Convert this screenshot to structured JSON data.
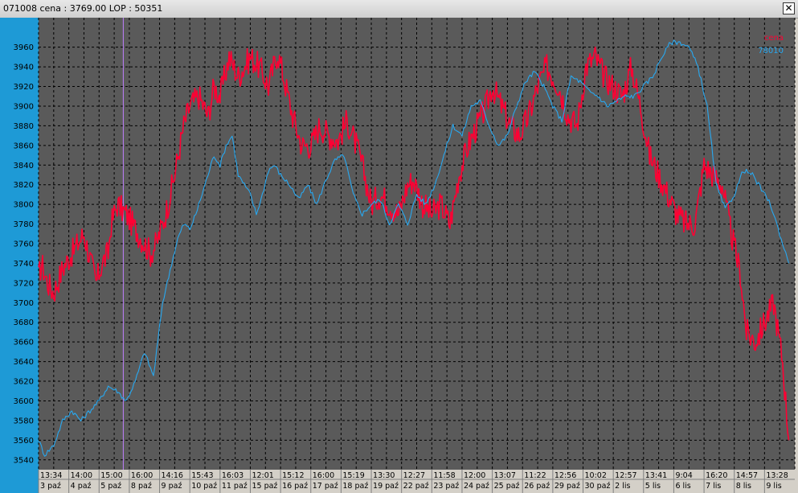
{
  "window": {
    "title": "071008  cena : 3769.00 LOP : 50351",
    "close_glyph": "✕"
  },
  "colors": {
    "plot_bg": "#5a5a5a",
    "axis_bg": "#1e9ad6",
    "grid": "#000000",
    "series_red": "#ff0033",
    "series_blue": "#28a8f0",
    "cursor": "#c080ff"
  },
  "chart_data": {
    "type": "line",
    "grid": true,
    "legend_position": "top-right",
    "ylim": [
      3530,
      3990
    ],
    "y_ticks": [
      3540,
      3560,
      3580,
      3600,
      3620,
      3640,
      3660,
      3680,
      3700,
      3720,
      3740,
      3760,
      3780,
      3800,
      3820,
      3840,
      3860,
      3880,
      3900,
      3920,
      3940,
      3960
    ],
    "x_time_labels": [
      "13:34",
      "14:00",
      "15:00",
      "16:00",
      "14:16",
      "15:43",
      "16:03",
      "12:01",
      "15:12",
      "16:00",
      "15:19",
      "13:30",
      "12:27",
      "11:58",
      "12:00",
      "13:07",
      "11:22",
      "12:56",
      "10:02",
      "12:57",
      "13:41",
      "9:04",
      "16:20",
      "14:57",
      "13:28"
    ],
    "x_date_labels": [
      "3 paź",
      "4 paź",
      "5 paź",
      "8 paź",
      "9 paź",
      "10 paź",
      "11 paź",
      "15 paź",
      "16 paź",
      "17 paź",
      "18 paź",
      "19 paź",
      "22 paź",
      "23 paź",
      "24 paź",
      "25 paź",
      "26 paź",
      "29 paź",
      "30 paź",
      "2 lis",
      "5 lis",
      "6 lis",
      "7 lis",
      "8 lis",
      "9 lis"
    ],
    "series": [
      {
        "name": "cena",
        "color": "#ff0033",
        "style": "noisy",
        "x": [
          0,
          1,
          3,
          5,
          8,
          11,
          15,
          17,
          19,
          21,
          23,
          24,
          26,
          29,
          33,
          37,
          39,
          42,
          45,
          48,
          50,
          53,
          56,
          58,
          60,
          63,
          66,
          70,
          73,
          76,
          79,
          81,
          84,
          87,
          90,
          93,
          96,
          99,
          102,
          105,
          107,
          110,
          113,
          116,
          119,
          122,
          124,
          127,
          130,
          133,
          136,
          139,
          142,
          145,
          148,
          150,
          153,
          156,
          159,
          162,
          165,
          168,
          172,
          175,
          178,
          181,
          184,
          187,
          190,
          193,
          196,
          199,
          202,
          205,
          208,
          211,
          214,
          217,
          220,
          223,
          226,
          229,
          232,
          234,
          237,
          240,
          243,
          246,
          248
        ],
        "y": [
          3725,
          3740,
          3720,
          3710,
          3735,
          3750,
          3770,
          3745,
          3720,
          3740,
          3750,
          3780,
          3800,
          3790,
          3770,
          3750,
          3760,
          3790,
          3830,
          3880,
          3900,
          3910,
          3890,
          3920,
          3910,
          3950,
          3930,
          3950,
          3940,
          3920,
          3955,
          3930,
          3890,
          3860,
          3860,
          3880,
          3870,
          3865,
          3885,
          3860,
          3840,
          3800,
          3810,
          3800,
          3790,
          3820,
          3825,
          3800,
          3790,
          3800,
          3780,
          3830,
          3860,
          3880,
          3900,
          3920,
          3900,
          3880,
          3870,
          3890,
          3920,
          3940,
          3920,
          3890,
          3880,
          3940,
          3950,
          3930,
          3920,
          3910,
          3940,
          3900,
          3850,
          3830,
          3810,
          3790,
          3780,
          3780,
          3840,
          3830,
          3820,
          3770,
          3730,
          3670,
          3660,
          3680,
          3700,
          3640,
          3560
        ]
      },
      {
        "name": "78010",
        "color": "#28a8f0",
        "style": "smooth",
        "x": [
          0,
          2,
          5,
          8,
          11,
          14,
          17,
          20,
          23,
          26,
          29,
          32,
          35,
          38,
          41,
          44,
          46,
          48,
          50,
          52,
          54,
          56,
          58,
          60,
          62,
          64,
          66,
          68,
          70,
          72,
          74,
          76,
          78,
          80,
          83,
          86,
          89,
          92,
          95,
          98,
          101,
          104,
          107,
          110,
          113,
          116,
          119,
          122,
          125,
          128,
          131,
          134,
          137,
          140,
          143,
          146,
          149,
          152,
          155,
          158,
          161,
          164,
          167,
          170,
          173,
          176,
          179,
          182,
          185,
          188,
          191,
          194,
          197,
          200,
          203,
          206,
          209,
          212,
          215,
          218,
          221,
          224,
          227,
          230,
          233,
          236,
          239,
          242,
          245,
          248
        ],
        "y": [
          3560,
          3545,
          3555,
          3580,
          3590,
          3580,
          3590,
          3600,
          3615,
          3610,
          3600,
          3620,
          3650,
          3625,
          3700,
          3740,
          3765,
          3780,
          3775,
          3790,
          3810,
          3830,
          3850,
          3840,
          3860,
          3870,
          3830,
          3820,
          3810,
          3790,
          3810,
          3835,
          3840,
          3830,
          3820,
          3805,
          3820,
          3800,
          3825,
          3845,
          3850,
          3810,
          3790,
          3800,
          3805,
          3780,
          3800,
          3780,
          3810,
          3800,
          3820,
          3850,
          3880,
          3870,
          3900,
          3905,
          3880,
          3860,
          3870,
          3900,
          3925,
          3935,
          3920,
          3900,
          3885,
          3930,
          3925,
          3915,
          3910,
          3900,
          3905,
          3910,
          3910,
          3920,
          3930,
          3950,
          3965,
          3965,
          3960,
          3940,
          3900,
          3820,
          3795,
          3810,
          3835,
          3830,
          3815,
          3800,
          3770,
          3740
        ]
      }
    ],
    "cursor_x": 28
  }
}
